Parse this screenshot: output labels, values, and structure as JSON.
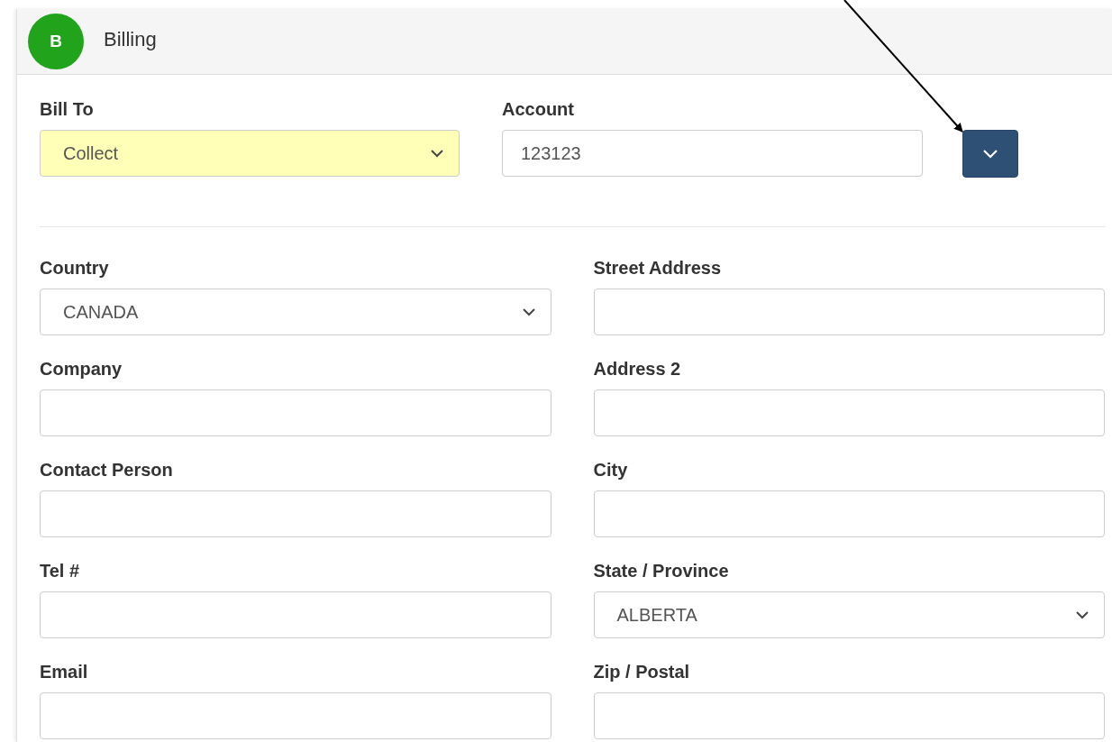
{
  "panel": {
    "badge": "B",
    "title": "Billing"
  },
  "top_fields": [
    {
      "label": "Bill To",
      "kind": "select",
      "value": "Collect",
      "highlighted": true
    },
    {
      "label": "Account",
      "kind": "input",
      "value": "123123",
      "highlighted": false
    }
  ],
  "fields": [
    {
      "label": "Country",
      "kind": "select",
      "value": "CANADA"
    },
    {
      "label": "Street Address",
      "kind": "input"
    },
    {
      "label": "Company",
      "kind": "input"
    },
    {
      "label": "Address 2",
      "kind": "input"
    },
    {
      "label": "Contact Person",
      "kind": "input"
    },
    {
      "label": "City",
      "kind": "input"
    },
    {
      "label": "Tel #",
      "kind": "input"
    },
    {
      "label": "State / Province",
      "kind": "select",
      "value": "ALBERTA"
    },
    {
      "label": "Email",
      "kind": "input"
    },
    {
      "label": "Zip / Postal",
      "kind": "input"
    }
  ]
}
